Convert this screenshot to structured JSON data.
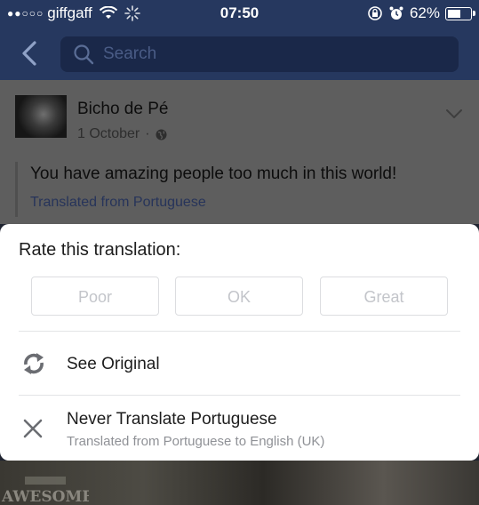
{
  "status_bar": {
    "carrier": "giffgaff",
    "time": "07:50",
    "battery_percent": "62%",
    "battery_level": 0.62,
    "signal_dots": "●●○○○"
  },
  "nav": {
    "search_placeholder": "Search"
  },
  "post": {
    "author": "Bicho de Pé",
    "date": "1 October",
    "separator": "·",
    "text": "You have amazing people too much in this world!",
    "translated_label": "Translated from Portuguese"
  },
  "sheet": {
    "title": "Rate this translation:",
    "ratings": {
      "poor": "Poor",
      "ok": "OK",
      "great": "Great"
    },
    "see_original": "See Original",
    "never_translate": "Never Translate Portuguese",
    "never_translate_sub": "Translated from Portuguese to English (UK)"
  },
  "background": {
    "logo_text": "AWESOME"
  },
  "colors": {
    "nav_bg": "#26385f",
    "search_bg": "#1a2849",
    "dim_post": "#5e5e5e",
    "link": "#27345a"
  }
}
